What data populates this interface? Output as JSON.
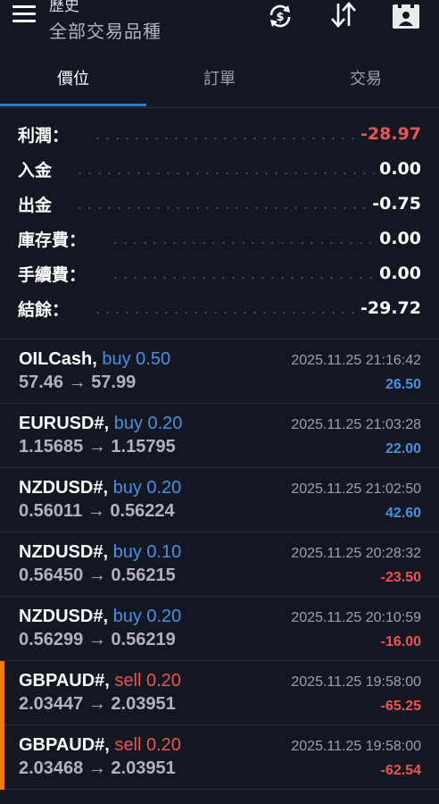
{
  "header": {
    "subtitle": "歷史",
    "title": "全部交易品種",
    "icons": [
      "currency-sync-icon",
      "sort-icon",
      "calendar-icon"
    ]
  },
  "tabs": [
    "價位",
    "訂單",
    "交易"
  ],
  "summary": [
    {
      "label": "利潤：",
      "value": "-28.97",
      "negative": true
    },
    {
      "label": "入金",
      "value": "0.00",
      "negative": false
    },
    {
      "label": "出金",
      "value": "-0.75",
      "negative": false
    },
    {
      "label": "庫存費：",
      "value": "0.00",
      "negative": false
    },
    {
      "label": "手續費：",
      "value": "0.00",
      "negative": false
    },
    {
      "label": "結餘：",
      "value": "-29.72",
      "negative": false
    }
  ],
  "trades": [
    {
      "symbol": "OILCash,",
      "side": "buy",
      "side_label": "buy 0.50",
      "open": "57.46",
      "arrow": "→",
      "close": "57.99",
      "time": "2025.11.25 21:16:42",
      "profit": "26.50"
    },
    {
      "symbol": "EURUSD#,",
      "side": "buy",
      "side_label": "buy 0.20",
      "open": "1.15685",
      "arrow": "→",
      "close": "1.15795",
      "time": "2025.11.25 21:03:28",
      "profit": "22.00"
    },
    {
      "symbol": "NZDUSD#,",
      "side": "buy",
      "side_label": "buy 0.20",
      "open": "0.56011",
      "arrow": "→",
      "close": "0.56224",
      "time": "2025.11.25 21:02:50",
      "profit": "42.60"
    },
    {
      "symbol": "NZDUSD#,",
      "side": "buy",
      "side_label": "buy 0.10",
      "open": "0.56450",
      "arrow": "→",
      "close": "0.56215",
      "time": "2025.11.25 20:28:32",
      "profit": "-23.50"
    },
    {
      "symbol": "NZDUSD#,",
      "side": "buy",
      "side_label": "buy 0.20",
      "open": "0.56299",
      "arrow": "→",
      "close": "0.56219",
      "time": "2025.11.25 20:10:59",
      "profit": "-16.00"
    },
    {
      "symbol": "GBPAUD#,",
      "side": "sell",
      "side_label": "sell 0.20",
      "open": "2.03447",
      "arrow": "→",
      "close": "2.03951",
      "time": "2025.11.25 19:58:00",
      "profit": "-65.25"
    },
    {
      "symbol": "GBPAUD#,",
      "side": "sell",
      "side_label": "sell 0.20",
      "open": "2.03468",
      "arrow": "→",
      "close": "2.03951",
      "time": "2025.11.25 19:58:00",
      "profit": "-62.54"
    }
  ],
  "colors": {
    "background": "#131722",
    "accent_blue": "#2f7dd9",
    "profit_positive": "#4a90e2",
    "profit_negative": "#ef5350",
    "sell_marker": "#f57c00"
  }
}
